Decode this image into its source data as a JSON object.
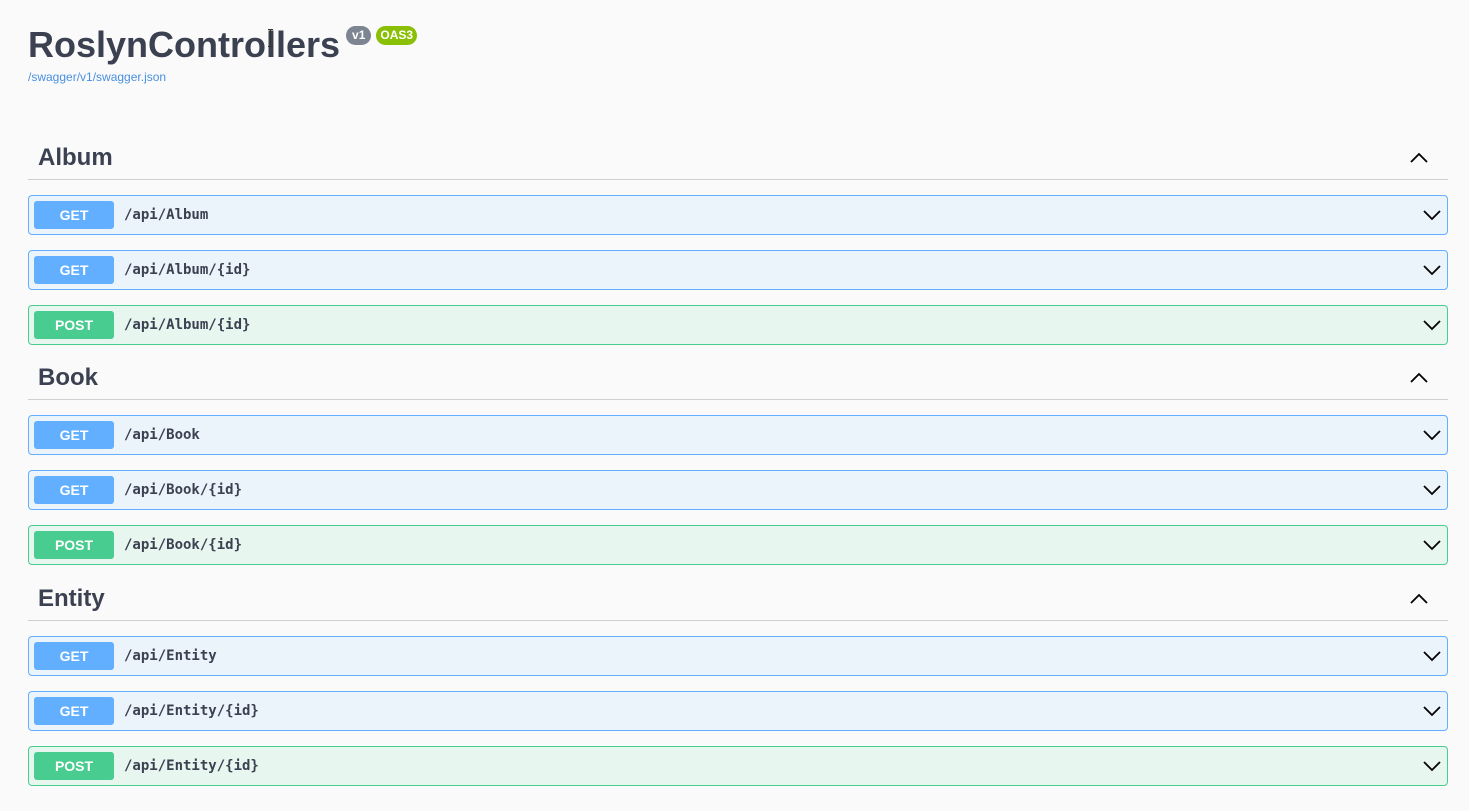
{
  "info": {
    "title": "RoslynControllers",
    "version_badge": "v1",
    "oas_badge": "OAS3",
    "spec_link": "/swagger/v1/swagger.json"
  },
  "tags": [
    {
      "name": "Album",
      "operations": [
        {
          "method": "GET",
          "path": "/api/Album"
        },
        {
          "method": "GET",
          "path": "/api/Album/{id}"
        },
        {
          "method": "POST",
          "path": "/api/Album/{id}"
        }
      ]
    },
    {
      "name": "Book",
      "operations": [
        {
          "method": "GET",
          "path": "/api/Book"
        },
        {
          "method": "GET",
          "path": "/api/Book/{id}"
        },
        {
          "method": "POST",
          "path": "/api/Book/{id}"
        }
      ]
    },
    {
      "name": "Entity",
      "operations": [
        {
          "method": "GET",
          "path": "/api/Entity"
        },
        {
          "method": "GET",
          "path": "/api/Entity/{id}"
        },
        {
          "method": "POST",
          "path": "/api/Entity/{id}"
        }
      ]
    }
  ],
  "icons": {
    "collapse": "chevron-up-icon",
    "expand": "chevron-down-icon"
  },
  "colors": {
    "get": "#61affe",
    "post": "#49cc90",
    "version_badge": "#7d8492",
    "oas_badge": "#89bf04",
    "link": "#4990e2"
  }
}
